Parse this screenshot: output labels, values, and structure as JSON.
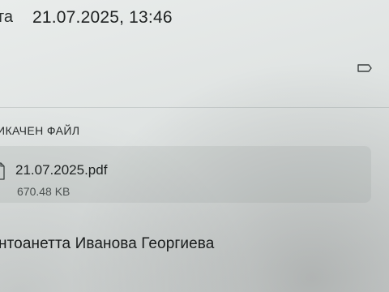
{
  "header": {
    "date_label": "та",
    "date_value": "21.07.2025, 13:46"
  },
  "attachment": {
    "section_label": "ИКАЧЕН ФАЙЛ",
    "file_name": "21.07.2025.pdf",
    "file_size": "670.48 KB",
    "icon": "file-icon"
  },
  "person": {
    "name": "нтоанетта Иванова Георгиева"
  },
  "icons": {
    "tag": "tag-icon"
  }
}
